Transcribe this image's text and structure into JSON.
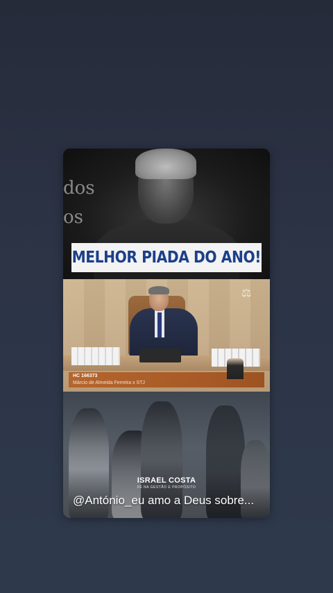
{
  "video_card": {
    "headline": "MELHOR PIADA DO ANO!",
    "background_words": [
      "dos",
      "os"
    ],
    "lower_third": {
      "case_number": "HC 166373",
      "case_parties": "Márcio de Almeida Ferreira x STJ"
    },
    "brand": {
      "name": "ISRAEL COSTA",
      "tagline": "FÉ NA GESTÃO E PROPÓSITO"
    },
    "caption": "@António_eu amo a Deus sobre..."
  },
  "colors": {
    "headline_text": "#1b3f8a",
    "headline_bg": "#f3f3f3",
    "lower_third": "#b5652d",
    "page_bg": "#2a3142"
  }
}
